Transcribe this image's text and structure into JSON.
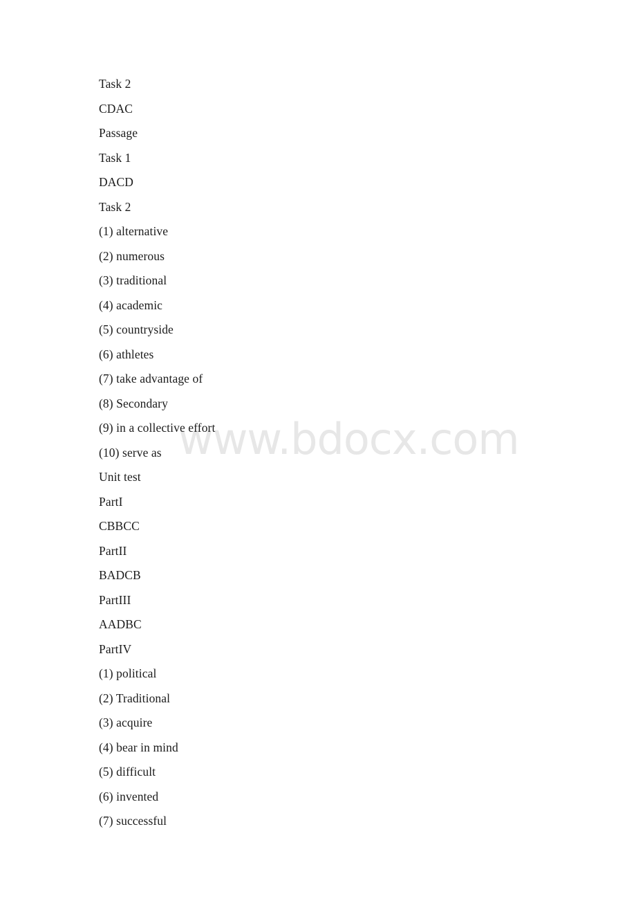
{
  "document": {
    "background_color": "#ffffff",
    "text_color": "#1b1b1b",
    "watermark": {
      "text": "www.bdocx.com",
      "color": "#e7e7e7"
    },
    "lines": [
      {
        "text": "Task 2"
      },
      {
        "text": "CDAC"
      },
      {
        "text": "Passage"
      },
      {
        "text": "Task 1"
      },
      {
        "text": "DACD"
      },
      {
        "text": "Task 2"
      },
      {
        "text": "(1) alternative"
      },
      {
        "text": "(2) numerous"
      },
      {
        "text": "(3) traditional"
      },
      {
        "text": "(4) academic"
      },
      {
        "text": "(5) countryside"
      },
      {
        "text": "(6) athletes"
      },
      {
        "text": "(7) take advantage of"
      },
      {
        "text": "(8) Secondary"
      },
      {
        "text": "(9) in a collective effort"
      },
      {
        "text": "(10) serve as"
      },
      {
        "text": "Unit test"
      },
      {
        "text": "PartI"
      },
      {
        "text": "CBBCC"
      },
      {
        "text": "PartII"
      },
      {
        "text": "BADCB"
      },
      {
        "text": "PartIII"
      },
      {
        "text": "AADBC"
      },
      {
        "text": "PartIV"
      },
      {
        "text": "(1) political"
      },
      {
        "text": "(2) Traditional"
      },
      {
        "text": "(3) acquire"
      },
      {
        "text": "(4) bear in mind"
      },
      {
        "text": "(5) difficult"
      },
      {
        "text": "(6) invented"
      },
      {
        "text": "(7) successful"
      }
    ]
  }
}
